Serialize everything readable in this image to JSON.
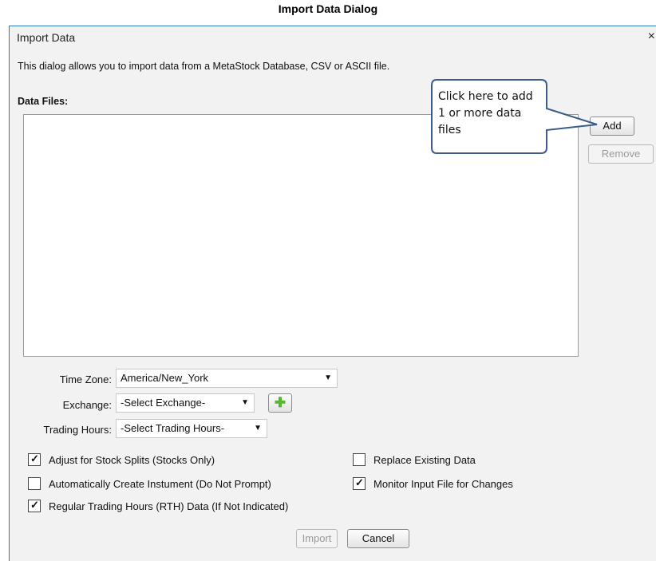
{
  "caption": "Import Data Dialog",
  "dialog": {
    "title": "Import Data",
    "close_glyph": "×",
    "description": "This dialog allows you to import data from a MetaStock Database, CSV or ASCII file.",
    "files_label": "Data Files:",
    "add_button": "Add",
    "remove_button": "Remove",
    "callout": "Click here to add 1 or more data files",
    "time_zone": {
      "label": "Time Zone:",
      "value": "America/New_York"
    },
    "exchange": {
      "label": "Exchange:",
      "value": "-Select Exchange-",
      "add_icon": "plus-icon"
    },
    "trading_hours": {
      "label": "Trading Hours:",
      "value": "-Select Trading Hours-"
    },
    "checkboxes": [
      {
        "label": "Adjust for Stock Splits (Stocks Only)",
        "checked": true
      },
      {
        "label": "Automatically Create Instument (Do Not Prompt)",
        "checked": false
      },
      {
        "label": "Regular Trading Hours (RTH) Data (If Not Indicated)",
        "checked": true
      },
      {
        "label": "Replace Existing Data",
        "checked": false
      },
      {
        "label": "Monitor Input File for Changes",
        "checked": true
      }
    ],
    "import_button": "Import",
    "cancel_button": "Cancel",
    "dropdown_arrow": "▼",
    "check_mark": "✓"
  }
}
